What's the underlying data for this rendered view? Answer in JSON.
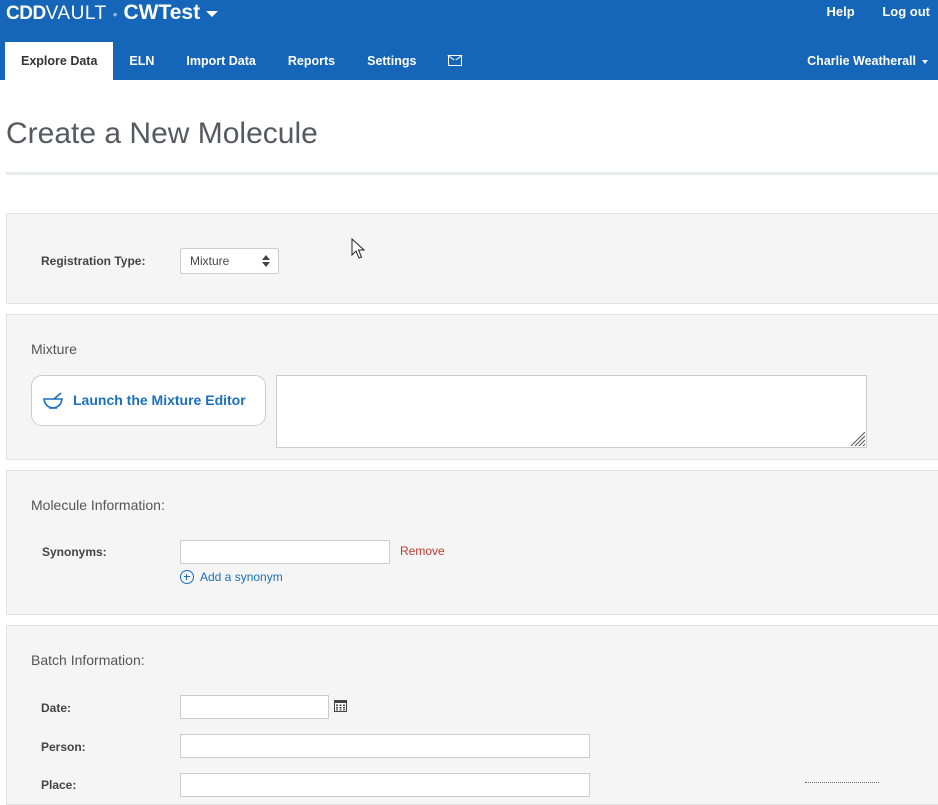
{
  "brand": {
    "cdd": "CDD",
    "vault": "VAULT",
    "vault_name": "CWTest"
  },
  "top_links": {
    "help": "Help",
    "logout": "Log out"
  },
  "tabs": [
    {
      "label": "Explore Data"
    },
    {
      "label": "ELN"
    },
    {
      "label": "Import Data"
    },
    {
      "label": "Reports"
    },
    {
      "label": "Settings"
    }
  ],
  "user": {
    "name": "Charlie Weatherall"
  },
  "page": {
    "title": "Create a New Molecule"
  },
  "registration": {
    "label": "Registration Type:",
    "selected": "Mixture"
  },
  "mixture": {
    "title": "Mixture",
    "launch_label": "Launch the Mixture Editor",
    "editor_value": ""
  },
  "molecule_info": {
    "title": "Molecule Information:",
    "synonyms_label": "Synonyms:",
    "synonym_value": "",
    "remove_label": "Remove",
    "add_synonym_label": "Add a synonym"
  },
  "batch_info": {
    "title": "Batch Information:",
    "date_label": "Date:",
    "date_value": "",
    "person_label": "Person:",
    "person_value": "",
    "place_label": "Place:",
    "place_value": ""
  },
  "colors": {
    "nav_blue": "#1565b8",
    "link_blue": "#1a6fbf",
    "remove_red": "#c0392b",
    "panel_bg": "#f5f5f5"
  },
  "icons": {
    "brand_caret": "chevron-down-icon",
    "mail": "mail-icon",
    "user_caret": "caret-down-icon",
    "launch": "mortar-pestle-icon",
    "add": "plus-circle-icon",
    "date": "calendar-icon"
  }
}
